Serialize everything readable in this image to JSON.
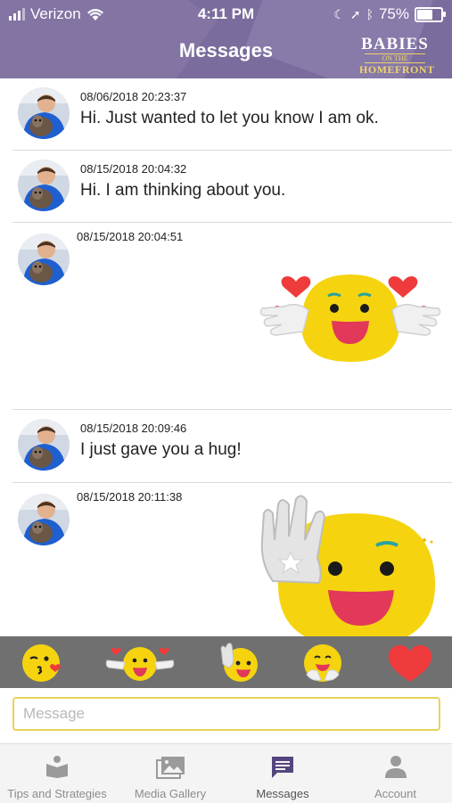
{
  "status": {
    "carrier": "Verizon",
    "time": "4:11 PM",
    "battery": "75%",
    "battery_level": 0.75
  },
  "header": {
    "title": "Messages",
    "logo_line1": "BABIES",
    "logo_line2": "ON THE",
    "logo_line3": "HOMEFRONT"
  },
  "messages": [
    {
      "timestamp": "08/06/2018 20:23:37",
      "text": "Hi. Just wanted  to let you know I am ok."
    },
    {
      "timestamp": "08/15/2018 20:04:32",
      "text": "Hi. I am thinking about you."
    },
    {
      "timestamp": "08/15/2018 20:04:51",
      "sticker": "hearts-hands-emoji-icon"
    },
    {
      "timestamp": "08/15/2018 20:09:46",
      "text": "I just gave you a hug!"
    },
    {
      "timestamp": "08/15/2018 20:11:38",
      "sticker": "waving-hand-emoji-icon"
    }
  ],
  "sticker_bar": [
    "kiss-emoji-icon",
    "hearts-hands-emoji-icon",
    "waving-emoji-icon",
    "hug-emoji-icon",
    "heart-icon"
  ],
  "composer": {
    "placeholder": "Message",
    "value": ""
  },
  "tabs": [
    {
      "label": "Tips and Strategies",
      "icon": "book-person-icon"
    },
    {
      "label": "Media Gallery",
      "icon": "gallery-icon"
    },
    {
      "label": "Messages",
      "icon": "message-icon",
      "active": true
    },
    {
      "label": "Account",
      "icon": "person-icon"
    }
  ],
  "colors": {
    "header": "#7a6c9c",
    "accent_yellow": "#e8d35a",
    "sticker_bar": "#707070",
    "emoji_yellow": "#f5d40f",
    "heart": "#ef3b3b"
  }
}
